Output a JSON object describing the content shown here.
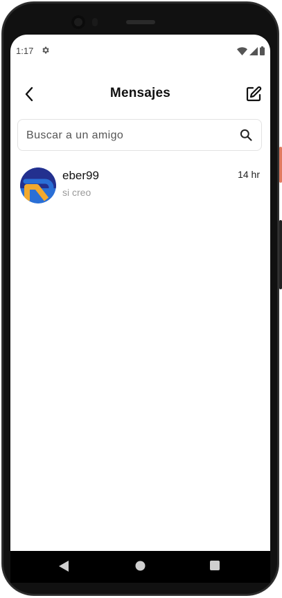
{
  "status_bar": {
    "time": "1:17",
    "icons": [
      "settings-gear-icon",
      "wifi-icon",
      "signal-icon",
      "battery-icon"
    ]
  },
  "app_bar": {
    "title": "Mensajes",
    "back_icon": "chevron-left-icon",
    "compose_icon": "edit-square-icon"
  },
  "search": {
    "placeholder": "Buscar a un amigo",
    "value": "",
    "icon": "search-icon"
  },
  "chats": [
    {
      "name": "eber99",
      "preview": "si creo",
      "time": "14 hr",
      "avatar": "logo-avatar"
    }
  ],
  "nav": {
    "icons": [
      "back-triangle-icon",
      "home-circle-icon",
      "recents-square-icon"
    ]
  },
  "colors": {
    "avatar_blue": "#2a6fd6",
    "avatar_navy": "#23308f",
    "avatar_yellow": "#f2a92e",
    "side_button_accent": "#e07a5f"
  }
}
